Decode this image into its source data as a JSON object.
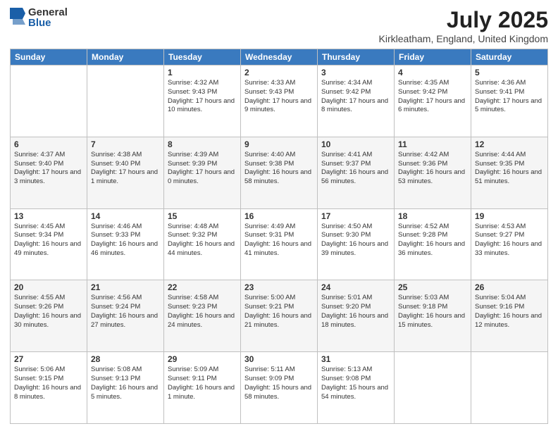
{
  "logo": {
    "general": "General",
    "blue": "Blue"
  },
  "title": "July 2025",
  "subtitle": "Kirkleatham, England, United Kingdom",
  "days_of_week": [
    "Sunday",
    "Monday",
    "Tuesday",
    "Wednesday",
    "Thursday",
    "Friday",
    "Saturday"
  ],
  "weeks": [
    [
      {
        "num": "",
        "info": ""
      },
      {
        "num": "",
        "info": ""
      },
      {
        "num": "1",
        "info": "Sunrise: 4:32 AM\nSunset: 9:43 PM\nDaylight: 17 hours and 10 minutes."
      },
      {
        "num": "2",
        "info": "Sunrise: 4:33 AM\nSunset: 9:43 PM\nDaylight: 17 hours and 9 minutes."
      },
      {
        "num": "3",
        "info": "Sunrise: 4:34 AM\nSunset: 9:42 PM\nDaylight: 17 hours and 8 minutes."
      },
      {
        "num": "4",
        "info": "Sunrise: 4:35 AM\nSunset: 9:42 PM\nDaylight: 17 hours and 6 minutes."
      },
      {
        "num": "5",
        "info": "Sunrise: 4:36 AM\nSunset: 9:41 PM\nDaylight: 17 hours and 5 minutes."
      }
    ],
    [
      {
        "num": "6",
        "info": "Sunrise: 4:37 AM\nSunset: 9:40 PM\nDaylight: 17 hours and 3 minutes."
      },
      {
        "num": "7",
        "info": "Sunrise: 4:38 AM\nSunset: 9:40 PM\nDaylight: 17 hours and 1 minute."
      },
      {
        "num": "8",
        "info": "Sunrise: 4:39 AM\nSunset: 9:39 PM\nDaylight: 17 hours and 0 minutes."
      },
      {
        "num": "9",
        "info": "Sunrise: 4:40 AM\nSunset: 9:38 PM\nDaylight: 16 hours and 58 minutes."
      },
      {
        "num": "10",
        "info": "Sunrise: 4:41 AM\nSunset: 9:37 PM\nDaylight: 16 hours and 56 minutes."
      },
      {
        "num": "11",
        "info": "Sunrise: 4:42 AM\nSunset: 9:36 PM\nDaylight: 16 hours and 53 minutes."
      },
      {
        "num": "12",
        "info": "Sunrise: 4:44 AM\nSunset: 9:35 PM\nDaylight: 16 hours and 51 minutes."
      }
    ],
    [
      {
        "num": "13",
        "info": "Sunrise: 4:45 AM\nSunset: 9:34 PM\nDaylight: 16 hours and 49 minutes."
      },
      {
        "num": "14",
        "info": "Sunrise: 4:46 AM\nSunset: 9:33 PM\nDaylight: 16 hours and 46 minutes."
      },
      {
        "num": "15",
        "info": "Sunrise: 4:48 AM\nSunset: 9:32 PM\nDaylight: 16 hours and 44 minutes."
      },
      {
        "num": "16",
        "info": "Sunrise: 4:49 AM\nSunset: 9:31 PM\nDaylight: 16 hours and 41 minutes."
      },
      {
        "num": "17",
        "info": "Sunrise: 4:50 AM\nSunset: 9:30 PM\nDaylight: 16 hours and 39 minutes."
      },
      {
        "num": "18",
        "info": "Sunrise: 4:52 AM\nSunset: 9:28 PM\nDaylight: 16 hours and 36 minutes."
      },
      {
        "num": "19",
        "info": "Sunrise: 4:53 AM\nSunset: 9:27 PM\nDaylight: 16 hours and 33 minutes."
      }
    ],
    [
      {
        "num": "20",
        "info": "Sunrise: 4:55 AM\nSunset: 9:26 PM\nDaylight: 16 hours and 30 minutes."
      },
      {
        "num": "21",
        "info": "Sunrise: 4:56 AM\nSunset: 9:24 PM\nDaylight: 16 hours and 27 minutes."
      },
      {
        "num": "22",
        "info": "Sunrise: 4:58 AM\nSunset: 9:23 PM\nDaylight: 16 hours and 24 minutes."
      },
      {
        "num": "23",
        "info": "Sunrise: 5:00 AM\nSunset: 9:21 PM\nDaylight: 16 hours and 21 minutes."
      },
      {
        "num": "24",
        "info": "Sunrise: 5:01 AM\nSunset: 9:20 PM\nDaylight: 16 hours and 18 minutes."
      },
      {
        "num": "25",
        "info": "Sunrise: 5:03 AM\nSunset: 9:18 PM\nDaylight: 16 hours and 15 minutes."
      },
      {
        "num": "26",
        "info": "Sunrise: 5:04 AM\nSunset: 9:16 PM\nDaylight: 16 hours and 12 minutes."
      }
    ],
    [
      {
        "num": "27",
        "info": "Sunrise: 5:06 AM\nSunset: 9:15 PM\nDaylight: 16 hours and 8 minutes."
      },
      {
        "num": "28",
        "info": "Sunrise: 5:08 AM\nSunset: 9:13 PM\nDaylight: 16 hours and 5 minutes."
      },
      {
        "num": "29",
        "info": "Sunrise: 5:09 AM\nSunset: 9:11 PM\nDaylight: 16 hours and 1 minute."
      },
      {
        "num": "30",
        "info": "Sunrise: 5:11 AM\nSunset: 9:09 PM\nDaylight: 15 hours and 58 minutes."
      },
      {
        "num": "31",
        "info": "Sunrise: 5:13 AM\nSunset: 9:08 PM\nDaylight: 15 hours and 54 minutes."
      },
      {
        "num": "",
        "info": ""
      },
      {
        "num": "",
        "info": ""
      }
    ]
  ]
}
